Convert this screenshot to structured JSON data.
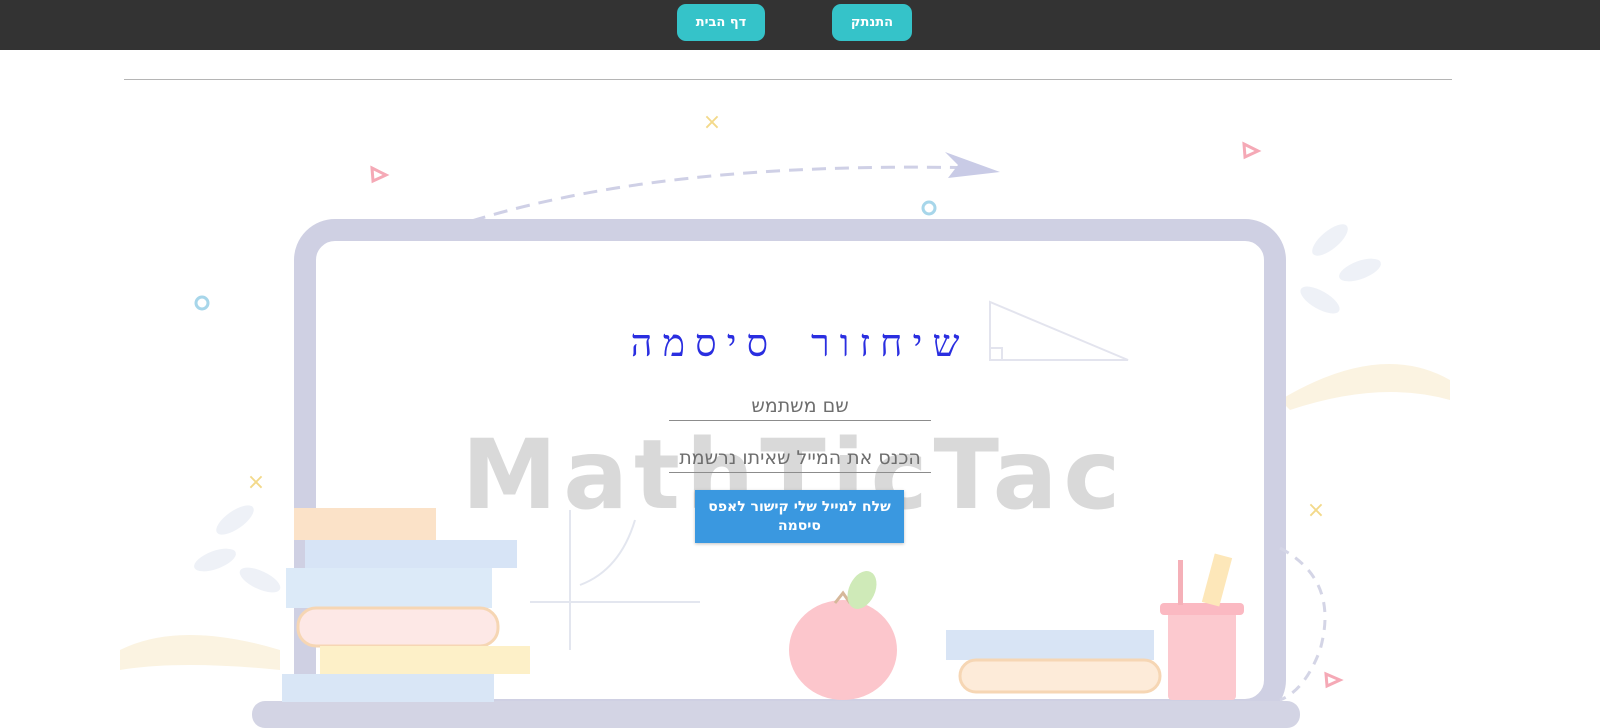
{
  "nav": {
    "home_label": "דף הבית",
    "logout_label": "התנתק"
  },
  "background": {
    "watermark_text": "MathTicTac"
  },
  "form": {
    "title": "שיחזור סיסמה",
    "username_placeholder": "שם משתמש",
    "email_placeholder": "הכנס את המייל שאיתו נרשמת",
    "submit_label": "שלח למייל שלי קישור לאפס סיסמה"
  },
  "colors": {
    "topbar": "#333333",
    "nav_button": "#35c3c9",
    "title": "#2a2ee0",
    "submit_button": "#3a98e0"
  }
}
